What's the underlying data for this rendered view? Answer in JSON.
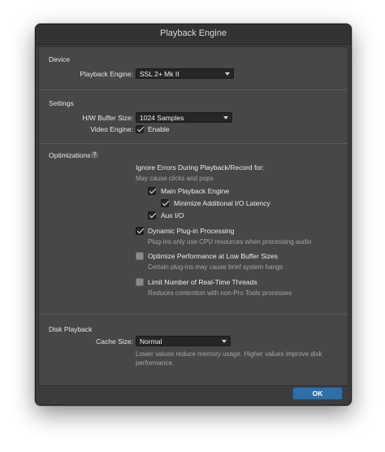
{
  "window": {
    "title": "Playback Engine"
  },
  "device": {
    "title": "Device",
    "playback_engine_label": "Playback Engine:",
    "playback_engine_value": "SSL 2+ Mk II"
  },
  "settings": {
    "title": "Settings",
    "buffer_label": "H/W Buffer Size:",
    "buffer_value": "1024 Samples",
    "video_label": "Video Engine:",
    "video_checkbox_label": "Enable",
    "video_enabled": true
  },
  "optimizations": {
    "title": "Optimizations",
    "help_glyph": "?",
    "ignore_errors_title": "Ignore Errors During Playback/Record for:",
    "ignore_errors_hint": "May cause clicks and pops",
    "main_playback_engine": {
      "label": "Main Playback Engine",
      "checked": true
    },
    "minimize_io_latency": {
      "label": "Minimize Additional I/O Latency",
      "checked": true
    },
    "aux_io": {
      "label": "Aux I/O",
      "checked": true
    },
    "dynamic_plugin": {
      "label": "Dynamic Plug-in Processing",
      "checked": true,
      "hint": "Plug-ins only use CPU resources when processing audio"
    },
    "optimize_low_buffer": {
      "label": "Optimize Performance at Low Buffer Sizes",
      "checked": false,
      "hint": "Certain plug-ins may cause brief system hangs"
    },
    "limit_threads": {
      "label": "Limit Number of Real-Time Threads",
      "checked": false,
      "hint": "Reduces contention with non-Pro Tools processes"
    }
  },
  "disk_playback": {
    "title": "Disk Playback",
    "cache_label": "Cache Size:",
    "cache_value": "Normal",
    "hint_line1": "Lower values reduce memory usage. Higher values improve disk",
    "hint_line2": "performance."
  },
  "footer": {
    "ok_label": "OK"
  },
  "colors": {
    "accent": "#2f6fa8",
    "panel": "#474747",
    "window": "#3c3c3c"
  }
}
